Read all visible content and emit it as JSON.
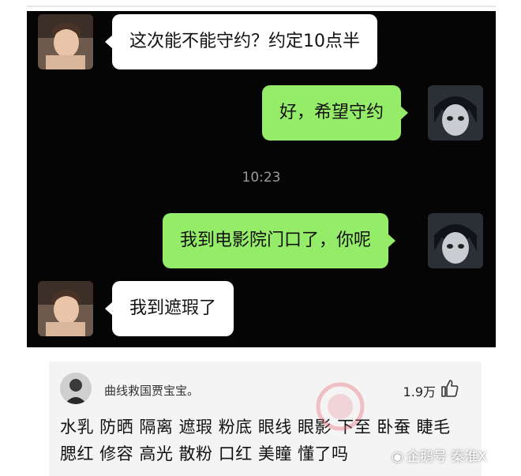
{
  "chat": {
    "messages": [
      {
        "side": "left",
        "text": "这次能不能守约？约定10点半"
      },
      {
        "side": "right",
        "text": "好，希望守约"
      },
      {
        "side": "right",
        "text": "我到电影院门口了，你呢"
      },
      {
        "side": "left",
        "text": "我到遮瑕了"
      }
    ],
    "timestamp": "10:23"
  },
  "comment": {
    "username": "曲线救国贾宝宝。",
    "likes": "1.9万",
    "body": "水乳 防晒 隔离 遮瑕 粉底 眼线 眼影 下至 卧蚕 睫毛 腮红 修容 高光 散粉 口红 美瞳 懂了吗"
  },
  "watermark": "企鹅号 秦淮X",
  "colors": {
    "chat_bg": "#050505",
    "bubble_sent": "#95ec69",
    "bubble_received": "#ffffff",
    "comment_bg": "#f4f4f4"
  },
  "icons": [
    "girl-avatar-icon",
    "anime-avatar-icon",
    "commenter-avatar-icon",
    "thumbs-up-icon",
    "penguin-icon"
  ]
}
